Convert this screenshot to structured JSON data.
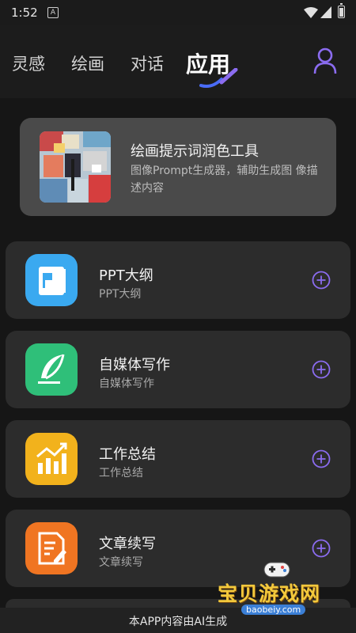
{
  "status_bar": {
    "time": "1:52",
    "a_icon": "A"
  },
  "tabs": [
    {
      "label": "灵感"
    },
    {
      "label": "绘画"
    },
    {
      "label": "对话"
    },
    {
      "label": "应用"
    }
  ],
  "feature": {
    "title": "绘画提示词润色工具",
    "description": "图像Prompt生成器，辅助生成图 像描述内容"
  },
  "apps": [
    {
      "title": "PPT大纲",
      "subtitle": "PPT大纲",
      "icon": "ppt-icon",
      "color": "#3aa9f0"
    },
    {
      "title": "自媒体写作",
      "subtitle": "自媒体写作",
      "icon": "feather-icon",
      "color": "#2fbf79"
    },
    {
      "title": "工作总结",
      "subtitle": "工作总结",
      "icon": "chart-icon",
      "color": "#f2b21c"
    },
    {
      "title": "文章续写",
      "subtitle": "文章续写",
      "icon": "document-edit-icon",
      "color": "#f07522"
    }
  ],
  "footer": {
    "text": "本APP内容由AI生成"
  },
  "watermark": {
    "title": "宝贝游戏网",
    "url": "baobeiy.com"
  },
  "colors": {
    "accent": "#8b6cf0",
    "background": "#161616",
    "card": "#2c2c2c",
    "feature_card": "#4a4a4a"
  }
}
